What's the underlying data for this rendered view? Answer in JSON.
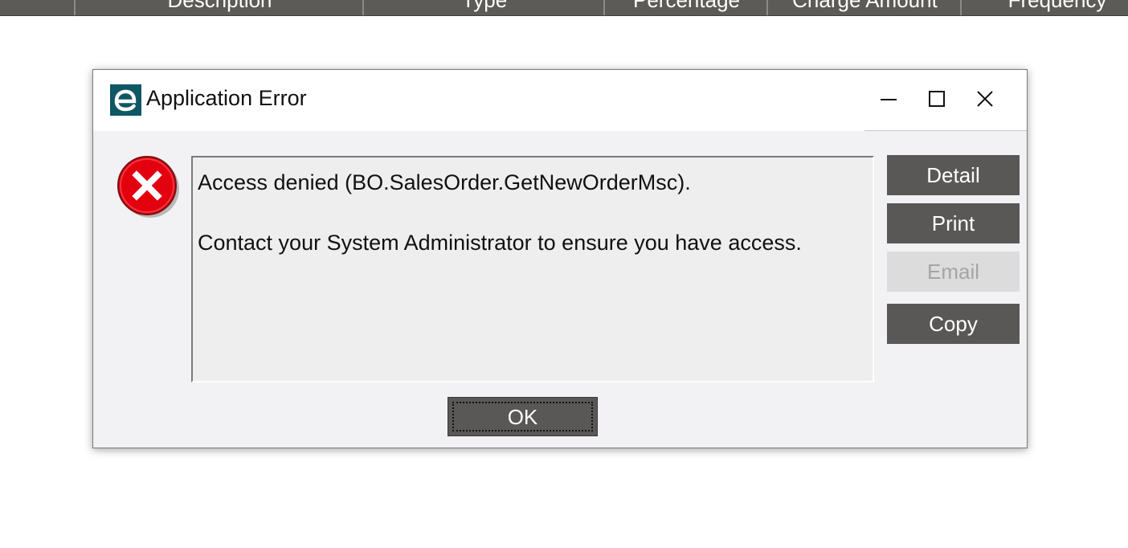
{
  "grid": {
    "columns": [
      "Description",
      "Type",
      "Percentage",
      "Charge Amount",
      "Frequency"
    ]
  },
  "dialog": {
    "title": "Application Error",
    "app_icon": "epicor-e-icon",
    "error_icon": "error-x-icon",
    "message_line1": "Access denied (BO.SalesOrder.GetNewOrderMsc).",
    "message_line2": "Contact your System Administrator to ensure you have access.",
    "buttons": {
      "detail": "Detail",
      "print": "Print",
      "email": "Email",
      "copy": "Copy",
      "ok": "OK"
    },
    "colors": {
      "button_bg": "#5a5857",
      "error_red": "#e3000f",
      "app_icon": "#0f5765"
    }
  }
}
